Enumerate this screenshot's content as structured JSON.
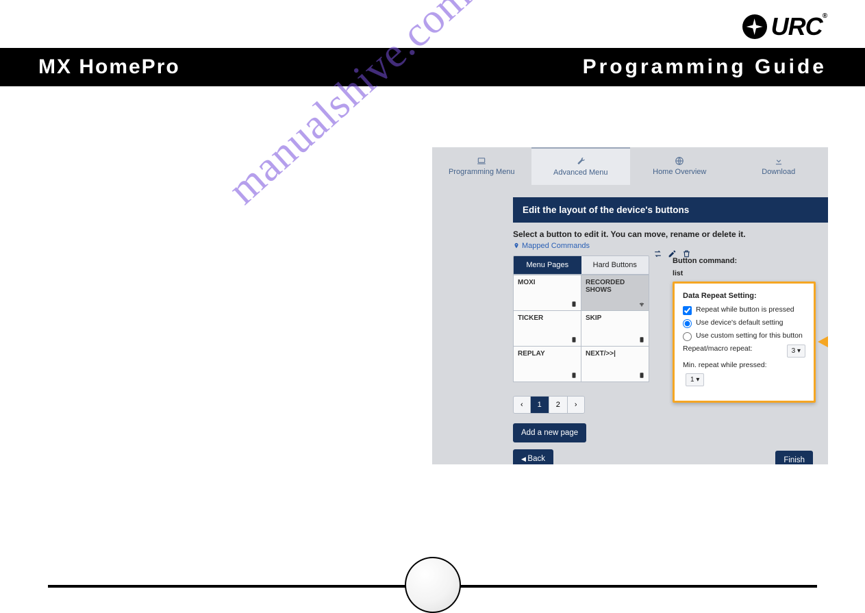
{
  "brand": {
    "logo_text": "URC",
    "reg_mark": "®"
  },
  "header": {
    "left": "MX HomePro",
    "right": "Programming Guide"
  },
  "watermark": "manualshive.com",
  "shot": {
    "tabs": [
      {
        "label": "Programming Menu"
      },
      {
        "label": "Advanced Menu"
      },
      {
        "label": "Home Overview"
      },
      {
        "label": "Download"
      }
    ],
    "panel_title": "Edit the layout of the device's buttons",
    "instruction": "Select a button to edit it. You can move, rename or delete it.",
    "mapped_label": "Mapped Commands",
    "tab_buttons": {
      "menu_pages": "Menu Pages",
      "hard_buttons": "Hard Buttons"
    },
    "grid": [
      {
        "label": "MOXI"
      },
      {
        "label": "RECORDED SHOWS",
        "selected": true
      },
      {
        "label": "TICKER"
      },
      {
        "label": "SKIP"
      },
      {
        "label": "REPLAY"
      },
      {
        "label": "NEXT/>>|"
      }
    ],
    "pager": {
      "prev": "‹",
      "pages": [
        "1",
        "2"
      ],
      "current": "1",
      "next": "›"
    },
    "add_page": "Add a new page",
    "back": "Back",
    "finish": "Finish",
    "button_command_label": "Button command:",
    "button_command_sub": "list",
    "repeat": {
      "header": "Data Repeat Setting:",
      "check_label": "Repeat while button is pressed",
      "radio1": "Use device's default setting",
      "radio2": "Use custom setting for this button",
      "repeat_macro_label": "Repeat/macro repeat:",
      "repeat_macro_value": "3",
      "min_repeat_label": "Min. repeat while pressed:",
      "min_repeat_value": "1"
    }
  }
}
